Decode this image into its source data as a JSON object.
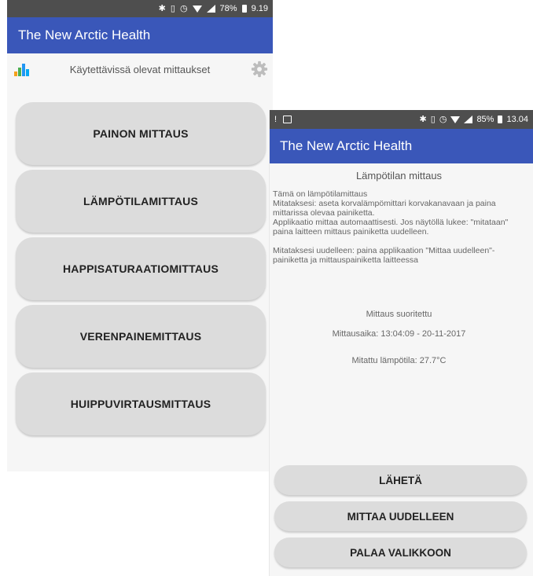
{
  "screen1": {
    "status": {
      "icons": [
        "bluetooth-icon",
        "vibrate-icon",
        "alarm-icon",
        "wifi-icon",
        "signal-icon"
      ],
      "battery": "78%",
      "time": "9.19"
    },
    "app_title": "The New Arctic Health",
    "header": {
      "title": "Käytettävissä olevat mittaukset",
      "left_icon": "bar-chart-icon",
      "right_icon": "gear-icon"
    },
    "menu": [
      {
        "label": "PAINON MITTAUS"
      },
      {
        "label": "LÄMPÖTILAMITTAUS"
      },
      {
        "label": "HAPPISATURAATIOMITTAUS"
      },
      {
        "label": "VERENPAINEMITTAUS"
      },
      {
        "label": "HUIPPUVIRTAUSMITTAUS"
      }
    ]
  },
  "screen2": {
    "status": {
      "left": "!",
      "icons": [
        "bluetooth-icon",
        "vibrate-icon",
        "alarm-icon",
        "wifi-icon",
        "signal-icon"
      ],
      "battery": "85%",
      "time": "13.04"
    },
    "app_title": "The New Arctic Health",
    "measure_title": "Lämpötilan mittaus",
    "instructions": [
      "Tämä on lämpötilamittaus",
      "Mitataksesi: aseta korvalämpömittari korvakanavaan ja paina mittarissa olevaa painiketta.",
      "Applikaatio mittaa automaattisesti. Jos näytöllä lukee: \"mitataan\" paina laitteen mittaus painiketta uudelleen.",
      "Mitataksesi uudelleen: paina applikaation \"Mittaa uudelleen\"-painiketta ja mittauspainiketta laitteessa"
    ],
    "result": {
      "status": "Mittaus suoritettu",
      "time": "Mittausaika: 13:04:09 - 20-11-2017",
      "temperature": "Mitattu lämpötila: 27.7°C"
    },
    "buttons": {
      "send": "LÄHETÄ",
      "remeasure": "MITTAA UUDELLEEN",
      "back": "PALAA VALIKKOON"
    }
  }
}
